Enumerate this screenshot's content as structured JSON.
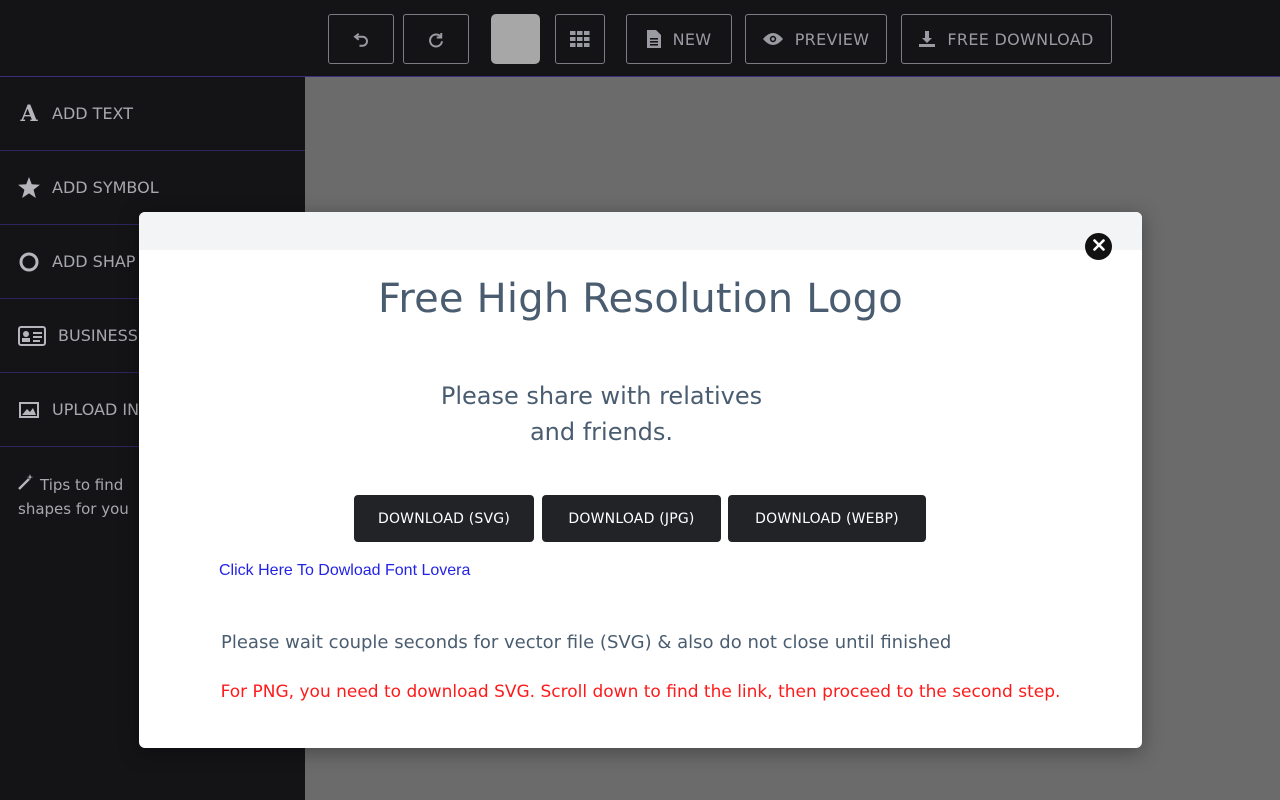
{
  "toolbar": {
    "undo_icon": "undo-icon",
    "redo_icon": "redo-icon",
    "color_swatch": "#a7a7a7",
    "grid_icon": "grid-icon",
    "new_label": "NEW",
    "preview_label": "PREVIEW",
    "download_label": "FREE DOWNLOAD"
  },
  "sidebar": {
    "items": [
      {
        "label": "ADD TEXT",
        "icon": "text-a-icon"
      },
      {
        "label": "ADD SYMBOL",
        "icon": "star-icon"
      },
      {
        "label": "ADD SHAP",
        "icon": "circle-icon"
      },
      {
        "label": "BUSINESS",
        "icon": "business-card-icon"
      },
      {
        "label": "UPLOAD IN",
        "icon": "image-icon"
      }
    ],
    "tips_line1": "Tips to find",
    "tips_line2": "shapes for you"
  },
  "modal": {
    "title": "Free High Resolution Logo",
    "subtitle_line1": "Please share with relatives",
    "subtitle_line2": "and friends.",
    "buttons": {
      "svg": "DOWNLOAD (SVG)",
      "jpg": "DOWNLOAD (JPG)",
      "webp": "DOWNLOAD (WEBP)"
    },
    "font_link": "Click Here To Dowload Font Lovera",
    "wait_note": "Please wait couple seconds for vector file (SVG) & also do not close until finished",
    "png_note": "For PNG, you need to download SVG. Scroll down to find the link, then proceed to the second step."
  },
  "colors": {
    "accent_divider": "#2b2660",
    "link_blue": "#2323e6",
    "warning_red": "#ff1a1a",
    "button_dark": "#222327"
  }
}
